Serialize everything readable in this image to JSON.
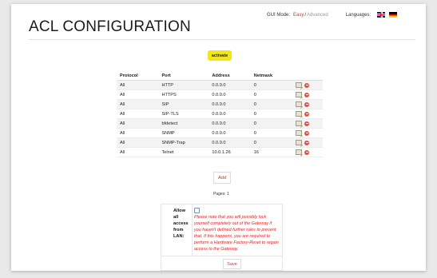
{
  "header": {
    "title": "ACL CONFIGURATION",
    "gui_mode_label": "GUI Mode:",
    "gui_mode_easy": "Easy",
    "gui_mode_separator": "/",
    "gui_mode_advanced": "Advanced",
    "languages_label": "Languages:",
    "flags": [
      "uk-flag-icon",
      "german-flag-icon"
    ]
  },
  "activate_label": "activate",
  "table": {
    "columns": [
      "Protocol",
      "Port",
      "Address",
      "Netmask",
      ""
    ],
    "rows": [
      {
        "protocol": "All",
        "port": "HTTP",
        "address": "0.0.0.0",
        "netmask": "0"
      },
      {
        "protocol": "All",
        "port": "HTTPS",
        "address": "0.0.0.0",
        "netmask": "0"
      },
      {
        "protocol": "All",
        "port": "SIP",
        "address": "0.0.0.0",
        "netmask": "0"
      },
      {
        "protocol": "All",
        "port": "SIP-TLS",
        "address": "0.0.0.0",
        "netmask": "0"
      },
      {
        "protocol": "All",
        "port": "bfdetect",
        "address": "0.0.0.0",
        "netmask": "0"
      },
      {
        "protocol": "All",
        "port": "SNMP",
        "address": "0.0.0.0",
        "netmask": "0"
      },
      {
        "protocol": "All",
        "port": "SNMP-Trap",
        "address": "0.0.0.0",
        "netmask": "0"
      },
      {
        "protocol": "All",
        "port": "Telnet",
        "address": "10.0.1.26",
        "netmask": "16"
      }
    ],
    "row_icons": [
      "edit-icon",
      "delete-icon"
    ]
  },
  "add_label": "Add",
  "pages_label": "Pages: 1",
  "lan": {
    "label": "Allow all access from LAN:",
    "checked": false,
    "warning": "Please note that you will possibly lock yourself completely out of the Gateway if you haven't defined further rules to prevent that. If this happens, you are required to perform a Hardware Factory-Reset to regain access to the Gateway.",
    "save_label": "Save"
  },
  "colors": {
    "accent_yellow": "#f4e614",
    "warning_red": "#e02020",
    "link_red": "#dd3333",
    "delete_red": "#e6503f"
  }
}
